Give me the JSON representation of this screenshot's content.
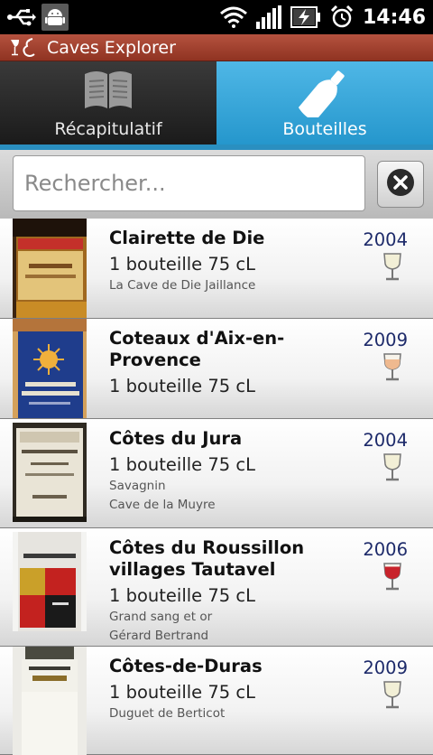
{
  "status_bar": {
    "time": "14:46",
    "icons": [
      "usb-icon",
      "android-debug-icon",
      "wifi-icon",
      "signal-icon",
      "battery-charging-icon",
      "alarm-clock-icon"
    ]
  },
  "app": {
    "title": "Caves Explorer",
    "logo": "wine-logo-icon"
  },
  "tabs": [
    {
      "label": "Récapitulatif",
      "icon": "book-icon",
      "active": false
    },
    {
      "label": "Bouteilles",
      "icon": "bottle-icon",
      "active": true
    }
  ],
  "search": {
    "placeholder": "Rechercher..."
  },
  "colors": {
    "title_bar": "#a5432f",
    "tab_active": "#36a6d9",
    "year_text": "#1d2a6a",
    "white_wine": "#f2efd6",
    "rose_wine": "#efb98f",
    "red_wine": "#c8232b"
  },
  "bottles": [
    {
      "name": "Clairette de Die",
      "quantity": "1 bouteille 75 cL",
      "details": [
        "La Cave de Die Jaillance"
      ],
      "year": "2004",
      "wine_type": "white"
    },
    {
      "name": "Coteaux d'Aix-en-Provence",
      "quantity": "1 bouteille 75 cL",
      "details": [],
      "year": "2009",
      "wine_type": "rose"
    },
    {
      "name": "Côtes du Jura",
      "quantity": "1 bouteille 75 cL",
      "details": [
        "Savagnin",
        "Cave de la Muyre"
      ],
      "year": "2004",
      "wine_type": "white"
    },
    {
      "name": "Côtes du Roussillon villages Tautavel",
      "quantity": "1 bouteille 75 cL",
      "details": [
        "Grand sang et or",
        "Gérard Bertrand"
      ],
      "year": "2006",
      "wine_type": "red"
    },
    {
      "name": "Côtes-de-Duras",
      "quantity": "1 bouteille 75 cL",
      "details": [
        "Duguet de Berticot"
      ],
      "year": "2009",
      "wine_type": "white"
    }
  ]
}
